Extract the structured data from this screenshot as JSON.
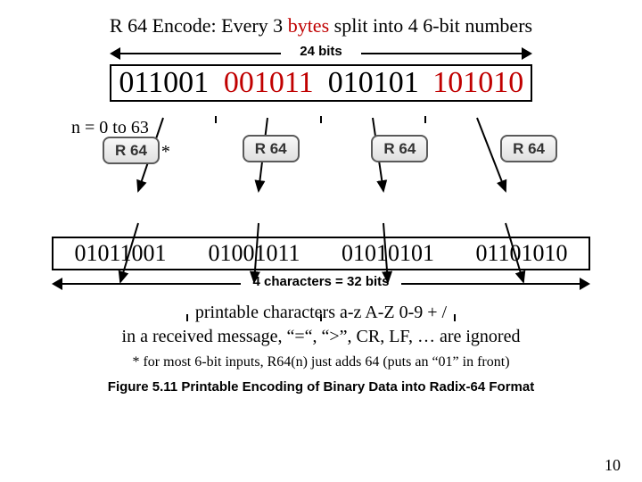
{
  "title": {
    "prefix": "R 64 Encode: Every 3 ",
    "red": "bytes",
    "suffix": " split into 4 6-bit numbers"
  },
  "arrow24_label": "24 bits",
  "input_groups": [
    "011001",
    "001011",
    "010101",
    "101010"
  ],
  "n_label": "n = 0 to 63",
  "r64_label": "R 64",
  "star": "*",
  "output_groups": [
    "01011001",
    "01001011",
    "01010101",
    "01101010"
  ],
  "arrow32_label": "4 characters = 32 bits",
  "desc_line1": "printable characters   a-z A-Z 0-9 + /",
  "desc_line2": "in a received message, “=“, “>”, CR, LF, … are ignored",
  "footnote": "* for most 6-bit inputs, R64(n) just adds 64 (puts an “01” in front)",
  "caption": "Figure 5.11   Printable Encoding of Binary Data into Radix-64 Format",
  "page": "10"
}
